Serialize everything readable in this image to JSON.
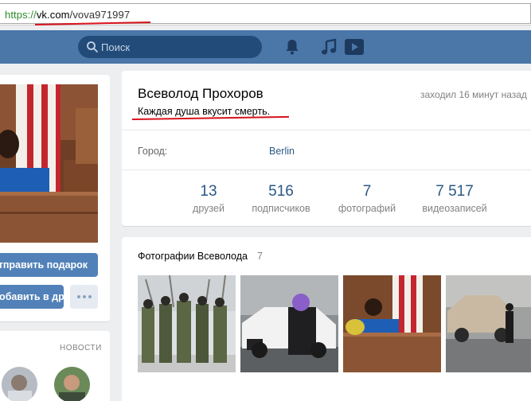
{
  "browser": {
    "url_scheme": "https://",
    "url_host": "vk.com",
    "url_path": "/vova971997"
  },
  "header": {
    "search_placeholder": "Поиск",
    "accent": "#4a76a8",
    "icons": [
      "search-icon",
      "bell-icon",
      "music-icon",
      "play-icon"
    ]
  },
  "left": {
    "gift_button": "Отправить подарок",
    "add_friend_button": "Добавить в друзья",
    "news_label": "НОВОСТИ"
  },
  "profile": {
    "name": "Всеволод Прохоров",
    "status": "Каждая душа вкусит смерть.",
    "online": "заходил 16 минут назад",
    "city_label": "Город:",
    "city_value": "Berlin",
    "stats": [
      {
        "num": "13",
        "label": "друзей"
      },
      {
        "num": "516",
        "label": "подписчиков"
      },
      {
        "num": "7",
        "label": "фотографий"
      },
      {
        "num": "7 517",
        "label": "видеозаписей"
      }
    ]
  },
  "photos": {
    "title": "Фотографии Всеволода",
    "count": "7"
  }
}
